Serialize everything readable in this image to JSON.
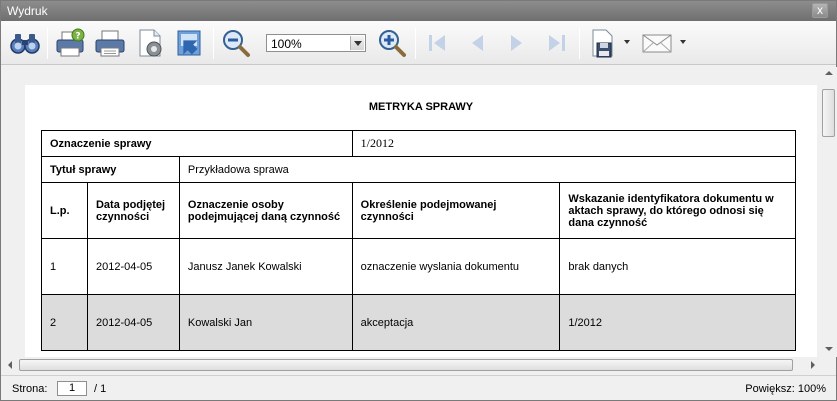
{
  "window": {
    "title": "Wydruk",
    "close_symbol": "x"
  },
  "toolbar": {
    "zoom_value": "100%",
    "buttons": [
      "find-icon",
      "print-icon",
      "quick-print-icon",
      "page-setup-icon",
      "export-icon",
      "zoom-out-icon",
      "zoom-in-icon",
      "first-page-icon",
      "previous-page-icon",
      "next-page-icon",
      "last-page-icon",
      "save-icon",
      "email-icon"
    ]
  },
  "document": {
    "title": "METRYKA SPRAWY",
    "case_mark_label": "Oznaczenie sprawy",
    "case_mark_value": "1/2012",
    "case_title_label": "Tytuł sprawy",
    "case_title_value": "Przykładowa sprawa",
    "headers": [
      "L.p.",
      "Data podjętej czynności",
      "Oznaczenie osoby podejmującej daną czynność",
      "Określenie podejmowanej czynności",
      "Wskazanie identyfikatora dokumentu w aktach sprawy, do którego odnosi się dana czynność"
    ],
    "rows": [
      [
        "1",
        "2012-04-05",
        "Janusz Janek Kowalski",
        "oznaczenie wyslania dokumentu",
        "brak danych"
      ],
      [
        "2",
        "2012-04-05",
        "Kowalski Jan",
        "akceptacja",
        "1/2012"
      ]
    ]
  },
  "status": {
    "page_label": "Strona:",
    "page_value": "1",
    "page_total": "/ 1",
    "zoom_label": "Powiększ: 100%"
  }
}
